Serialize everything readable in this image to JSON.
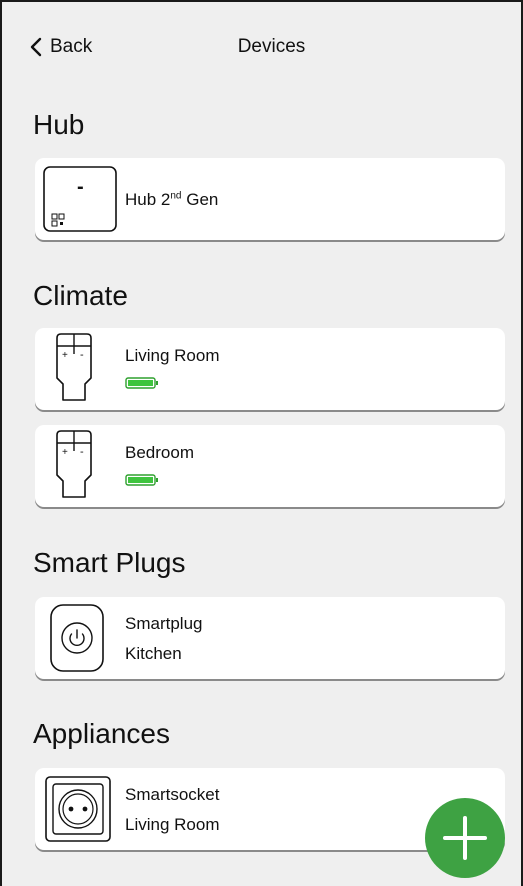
{
  "header": {
    "back_label": "Back",
    "title": "Devices"
  },
  "sections": {
    "hub": {
      "title": "Hub",
      "device": {
        "name": "Hub 2",
        "sup": "nd",
        "suffix": " Gen",
        "display": "-"
      }
    },
    "climate": {
      "title": "Climate",
      "devices": [
        {
          "name": "Living Room",
          "battery_level": 1.0,
          "battery_color": "#3ec43e"
        },
        {
          "name": "Bedroom",
          "battery_level": 1.0,
          "battery_color": "#3ec43e"
        }
      ],
      "thermostat_marks": {
        "plus": "+",
        "minus": "-"
      }
    },
    "smart_plugs": {
      "title": "Smart Plugs",
      "device": {
        "line1": "Smartplug",
        "line2": "Kitchen"
      }
    },
    "appliances": {
      "title": "Appliances",
      "device": {
        "line1": "Smartsocket",
        "line2": "Living Room"
      }
    }
  },
  "fab": {
    "icon": "plus-icon",
    "color": "#3ea243"
  }
}
